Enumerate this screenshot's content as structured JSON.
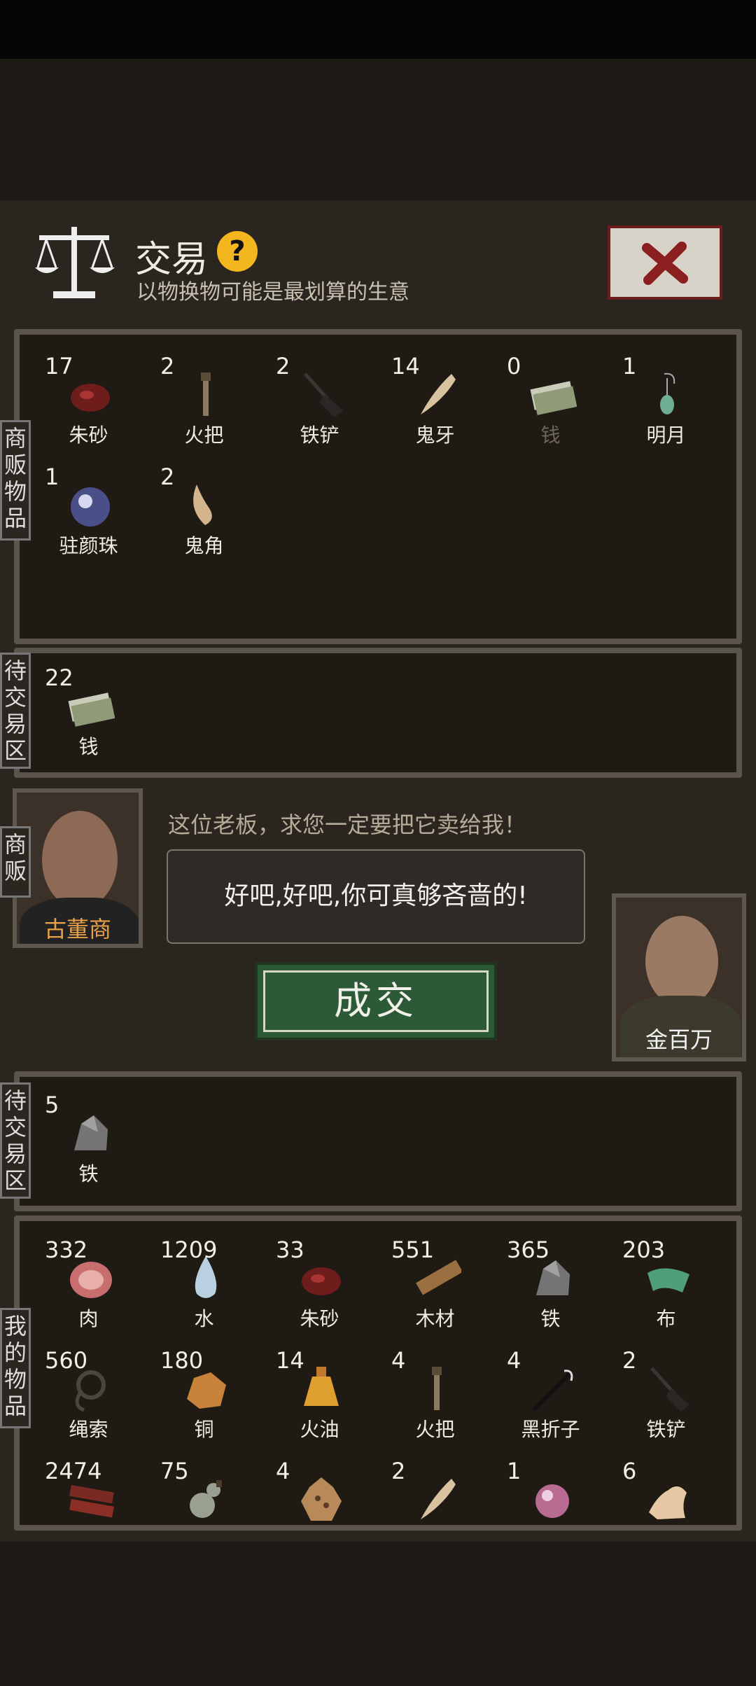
{
  "header": {
    "title": "交易",
    "help_glyph": "?",
    "subtitle": "以物换物可能是最划算的生意",
    "scale_icon": "scale-icon",
    "close_icon": "close-x-icon"
  },
  "side_labels": {
    "merchant_items": "商贩物品",
    "pending_trade_top": "待交易区",
    "merchant": "商贩",
    "pending_trade_bottom": "待交易区",
    "my_items": "我的物品"
  },
  "merchant_items": [
    {
      "count": "17",
      "name": "朱砂",
      "icon": "cinnabar-icon"
    },
    {
      "count": "2",
      "name": "火把",
      "icon": "torch-icon"
    },
    {
      "count": "2",
      "name": "铁铲",
      "icon": "shovel-icon"
    },
    {
      "count": "14",
      "name": "鬼牙",
      "icon": "fang-icon"
    },
    {
      "count": "0",
      "name": "钱",
      "icon": "money-icon",
      "dim": true
    },
    {
      "count": "1",
      "name": "明月",
      "icon": "jade-earring-icon"
    },
    {
      "count": "1",
      "name": "驻颜珠",
      "icon": "pearl-orb-icon"
    },
    {
      "count": "2",
      "name": "鬼角",
      "icon": "horn-icon"
    }
  ],
  "merchant_pending": [
    {
      "count": "22",
      "name": "钱",
      "icon": "money-icon"
    }
  ],
  "merchant_portrait": {
    "name": "古董商",
    "name_color": "#e8a14a"
  },
  "player_portrait": {
    "name": "金百万",
    "name_color": "#f2f2f2"
  },
  "dialog": {
    "request": "这位老板，求您一定要把它卖给我！",
    "reply": "好吧,好吧,你可真够吝啬的!"
  },
  "deal_button": "成交",
  "player_pending": [
    {
      "count": "5",
      "name": "铁",
      "icon": "iron-ore-icon"
    }
  ],
  "my_items": [
    {
      "count": "332",
      "name": "肉",
      "icon": "meat-icon"
    },
    {
      "count": "1209",
      "name": "水",
      "icon": "water-drop-icon"
    },
    {
      "count": "33",
      "name": "朱砂",
      "icon": "cinnabar-icon"
    },
    {
      "count": "551",
      "name": "木材",
      "icon": "wood-icon"
    },
    {
      "count": "365",
      "name": "铁",
      "icon": "iron-ore-icon"
    },
    {
      "count": "203",
      "name": "布",
      "icon": "cloth-icon"
    },
    {
      "count": "560",
      "name": "绳索",
      "icon": "rope-icon"
    },
    {
      "count": "180",
      "name": "铜",
      "icon": "copper-icon"
    },
    {
      "count": "14",
      "name": "火油",
      "icon": "oil-bottle-icon"
    },
    {
      "count": "4",
      "name": "火把",
      "icon": "torch-icon"
    },
    {
      "count": "4",
      "name": "黑折子",
      "icon": "black-rod-icon"
    },
    {
      "count": "2",
      "name": "铁铲",
      "icon": "shovel-icon"
    },
    {
      "count": "2474",
      "name": "",
      "icon": "jerky-icon"
    },
    {
      "count": "75",
      "name": "",
      "icon": "gourd-icon"
    },
    {
      "count": "4",
      "name": "",
      "icon": "pelt-icon"
    },
    {
      "count": "2",
      "name": "",
      "icon": "fang-icon"
    },
    {
      "count": "1",
      "name": "",
      "icon": "pink-pearl-icon"
    },
    {
      "count": "6",
      "name": "",
      "icon": "bone-icon"
    }
  ],
  "colors": {
    "panel_bg": "#2a251e",
    "slot_bracket": "#3e3830",
    "selected_bracket": "#e89a2a",
    "deal_green": "#2d5a36",
    "help_yellow": "#f3b61e",
    "close_red": "#8b1f1f"
  }
}
